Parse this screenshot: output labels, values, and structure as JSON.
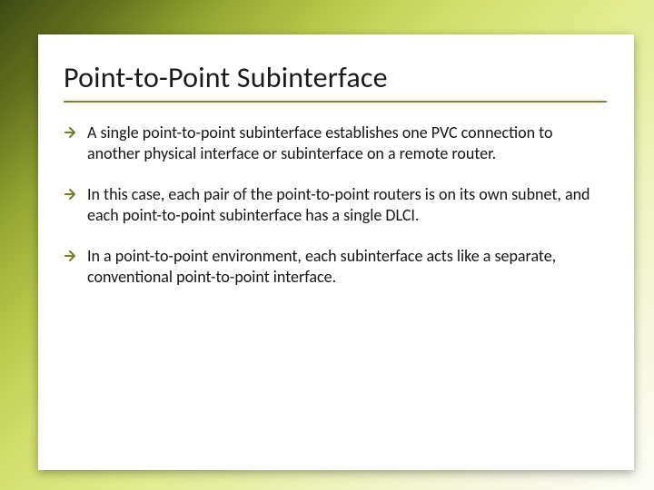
{
  "slide": {
    "title": "Point-to-Point Subinterface",
    "bullets": [
      "A single point-to-point subinterface establishes one PVC connection to another physical interface or subinterface on a remote router.",
      " In this case, each pair of the point-to-point routers is on its own subnet, and each point-to-point subinterface has a single DLCI.",
      "In a point-to-point environment, each subinterface acts like a separate, conventional point-to-point interface."
    ],
    "bullet_icon": "arrow-right-icon"
  }
}
